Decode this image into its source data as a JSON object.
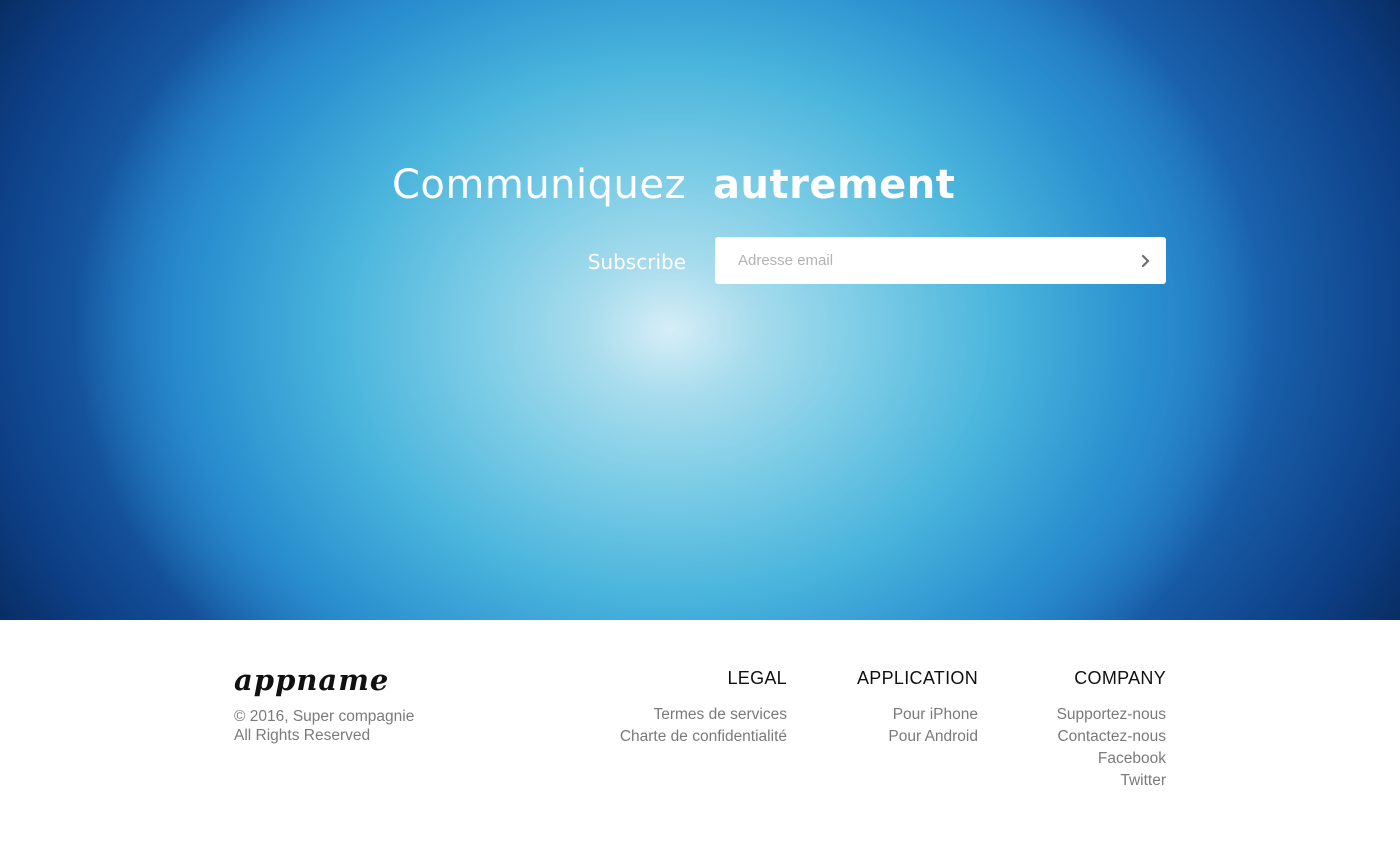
{
  "hero": {
    "title_part1": "Communiquez",
    "title_part2": "autrement",
    "subscribe_label": "Subscribe",
    "email_placeholder": "Adresse email",
    "submit_icon": "chevron-right-icon"
  },
  "footer": {
    "logo": "appname",
    "copyright_line1": "© 2016, Super compagnie",
    "copyright_line2": "All Rights Reserved",
    "legal": {
      "heading": "LEGAL",
      "links": [
        "Termes de services",
        "Charte de confidentialité"
      ]
    },
    "application": {
      "heading": "APPLICATION",
      "links": [
        "Pour iPhone",
        "Pour Android"
      ]
    },
    "company": {
      "heading": "COMPANY",
      "links": [
        "Supportez-nous",
        "Contactez-nous",
        "Facebook",
        "Twitter"
      ]
    }
  },
  "colors": {
    "hero_center": "#d6eef7",
    "hero_edge": "#041a3e",
    "footer_bg": "#ffffff",
    "link_gray": "#7a7a7a"
  }
}
